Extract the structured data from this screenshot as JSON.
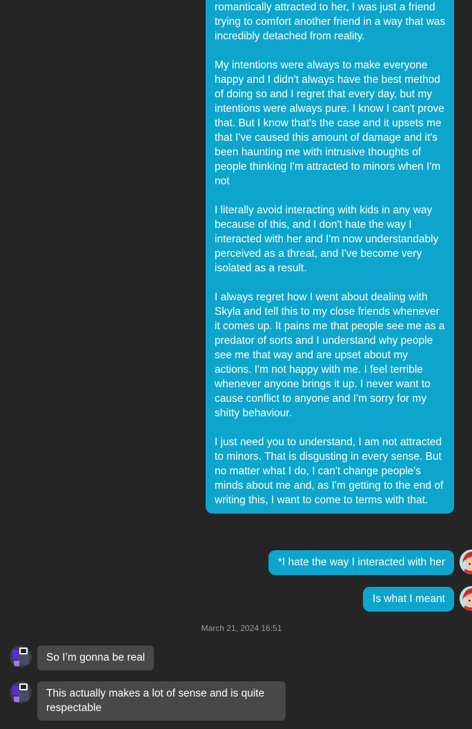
{
  "conversation": {
    "outgoing_long": {
      "paragraphs": [
        "romantically attracted to her, I was just a friend trying to comfort another friend in a way that was incredibly detached from reality.",
        "My intentions were always to make everyone happy and I didn't always have the best method of doing so and I regret that every day, but my intentions were always pure. I know I can't prove that. But I know that's the case and it upsets me that I've caused this amount of damage and it's been haunting me with intrusive thoughts of people thinking I'm attracted to minors when I'm not",
        "I literally avoid interacting with kids in any way because of this, and I don't hate the way I interacted with her and I'm now understandably perceived as a threat, and I've become very isolated as a result.",
        "I always regret how I went about dealing with Skyla and tell this to my close friends whenever it comes up. It pains me that people see me as a predator of sorts and I understand why people see me that way and are upset about my actions. I'm not happy with me. I feel terrible whenever anyone brings it up. I never want to cause conflict to anyone and I'm sorry for my shitty behaviour.",
        "I just need you to understand, I am not attracted to minors. That is disgusting in every sense. But no matter what I do, I can't change people's minds about me and, as I'm getting to the end of writing this, I want to come to terms with that."
      ]
    },
    "outgoing_correction": "*I hate the way I interacted with her",
    "outgoing_clarify": "Is what I meant",
    "timestamp": "March 21, 2024 16:51",
    "incoming_1": "So I’m gonna be real",
    "incoming_2": "This actually makes a lot of sense and is quite respectable"
  },
  "colors": {
    "background": "#252525",
    "outgoing_bubble": "#0ea5cd",
    "incoming_bubble": "#484848",
    "text": "#ffffff",
    "timestamp": "#9a9a9a"
  },
  "icons": {
    "my_avatar": "avatar-red-hood",
    "their_avatar": "avatar-purple-character"
  }
}
